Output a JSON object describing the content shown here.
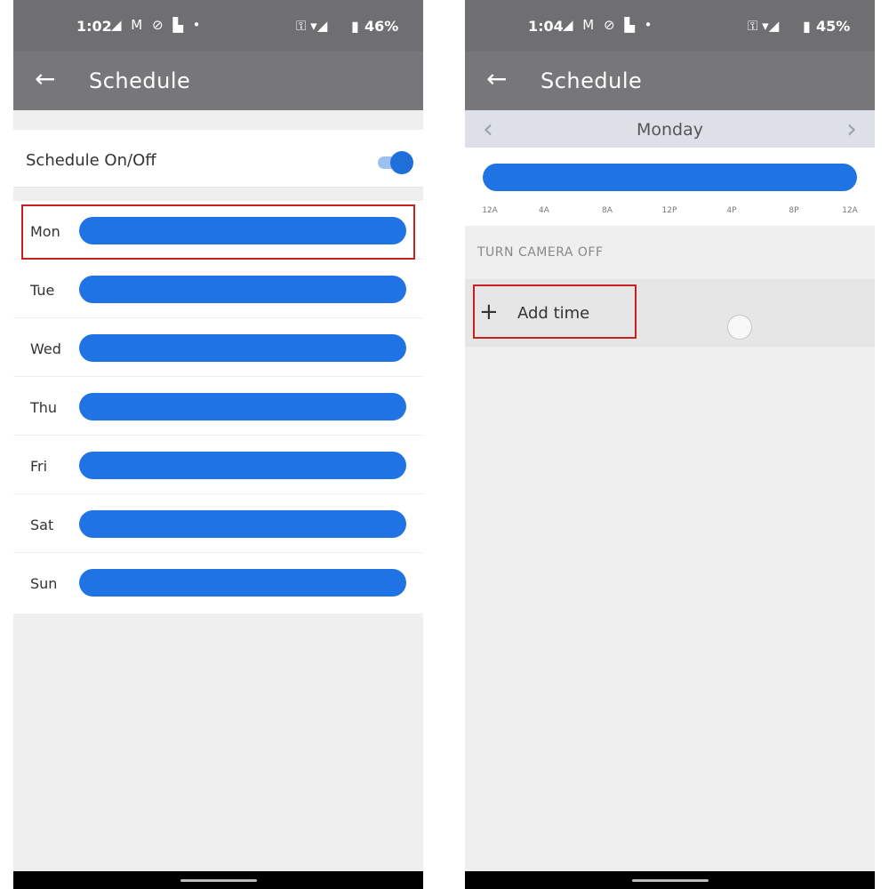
{
  "left_phone": {
    "status": {
      "time": "1:02",
      "notifications": "◢ M ⊘ ▙ •",
      "system": "⚿ ▾◢",
      "battery": "46%"
    },
    "appbar": {
      "title": "Schedule"
    },
    "schedule_toggle": {
      "label": "Schedule On/Off",
      "state": "on"
    },
    "days": [
      {
        "label": "Mon",
        "selected": true
      },
      {
        "label": "Tue"
      },
      {
        "label": "Wed"
      },
      {
        "label": "Thu"
      },
      {
        "label": "Fri"
      },
      {
        "label": "Sat"
      },
      {
        "label": "Sun"
      }
    ]
  },
  "right_phone": {
    "status": {
      "time": "1:04",
      "notifications": "◢ M ⊘ ▙ •",
      "system": "⚿ ▾◢",
      "battery": "45%"
    },
    "appbar": {
      "title": "Schedule"
    },
    "day_nav": {
      "day": "Monday"
    },
    "timeline_ticks": [
      "12A",
      "4A",
      "8A",
      "12P",
      "4P",
      "8P",
      "12A"
    ],
    "section_label": "TURN CAMERA OFF",
    "add_time": {
      "label": "Add time",
      "icon": "plus-icon"
    }
  },
  "colors": {
    "accent": "#1f73e3",
    "highlight": "#cc1f1f",
    "appbar": "#77777a"
  }
}
